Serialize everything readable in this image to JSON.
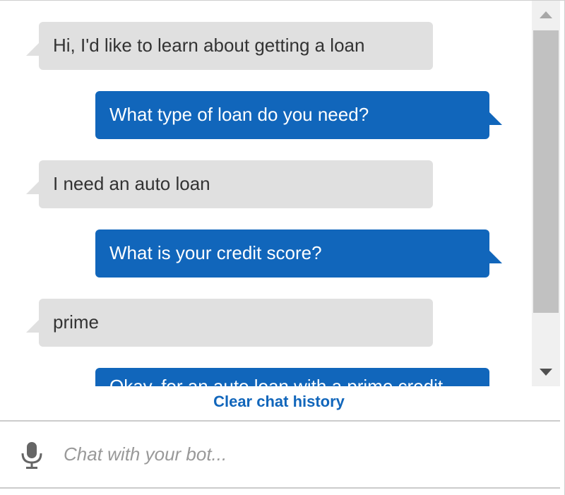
{
  "messages": [
    {
      "sender": "user",
      "text": "Hi, I'd like to learn about getting a loan"
    },
    {
      "sender": "bot",
      "text": "What type of loan do you need?"
    },
    {
      "sender": "user",
      "text": "I need an auto loan"
    },
    {
      "sender": "bot",
      "text": "What is your credit score?"
    },
    {
      "sender": "user",
      "text": "prime"
    },
    {
      "sender": "bot",
      "text": "Okay, for an auto loan with a prime credit"
    }
  ],
  "clear_history_label": "Clear chat history",
  "input": {
    "placeholder": "Chat with your bot...",
    "value": ""
  },
  "icons": {
    "mic": "microphone-icon",
    "scroll_up": "triangle-up-icon",
    "scroll_down": "triangle-down-icon"
  },
  "colors": {
    "bot_bubble": "#1166bb",
    "user_bubble": "#e0e0e0",
    "link": "#1166bb"
  }
}
